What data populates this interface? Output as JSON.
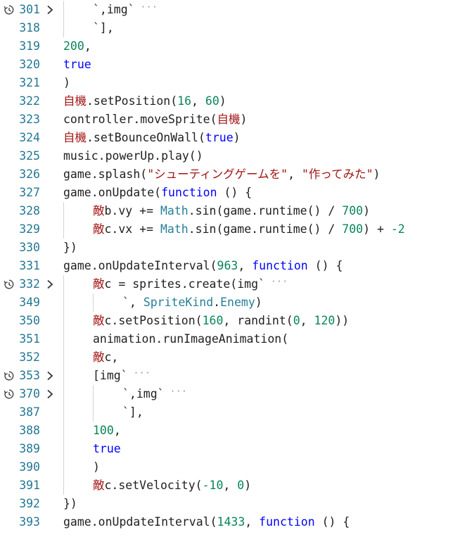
{
  "editor": {
    "lines": [
      {
        "num": "301",
        "folded": true,
        "indent": 1,
        "tokens": [
          {
            "t": "`,img`",
            "c": "id"
          },
          {
            "t": " ···",
            "c": "dots"
          }
        ]
      },
      {
        "num": "318",
        "indent": 1,
        "tokens": [
          {
            "t": "`],",
            "c": "id"
          }
        ]
      },
      {
        "num": "319",
        "indent": 0,
        "tokens": [
          {
            "t": "200",
            "c": "num"
          },
          {
            "t": ",",
            "c": "id"
          }
        ]
      },
      {
        "num": "320",
        "indent": 0,
        "tokens": [
          {
            "t": "true",
            "c": "kw"
          }
        ]
      },
      {
        "num": "321",
        "indent": 0,
        "tokens": [
          {
            "t": ")",
            "c": "id"
          }
        ]
      },
      {
        "num": "322",
        "indent": 0,
        "tokens": [
          {
            "t": "自機",
            "c": "jp"
          },
          {
            "t": ".setPosition(",
            "c": "id"
          },
          {
            "t": "16",
            "c": "num"
          },
          {
            "t": ", ",
            "c": "id"
          },
          {
            "t": "60",
            "c": "num"
          },
          {
            "t": ")",
            "c": "id"
          }
        ]
      },
      {
        "num": "323",
        "indent": 0,
        "tokens": [
          {
            "t": "controller.moveSprite(",
            "c": "id"
          },
          {
            "t": "自機",
            "c": "jp"
          },
          {
            "t": ")",
            "c": "id"
          }
        ]
      },
      {
        "num": "324",
        "indent": 0,
        "tokens": [
          {
            "t": "自機",
            "c": "jp"
          },
          {
            "t": ".setBounceOnWall(",
            "c": "id"
          },
          {
            "t": "true",
            "c": "kw"
          },
          {
            "t": ")",
            "c": "id"
          }
        ]
      },
      {
        "num": "325",
        "indent": 0,
        "tokens": [
          {
            "t": "music.powerUp.play()",
            "c": "id"
          }
        ]
      },
      {
        "num": "326",
        "indent": 0,
        "tokens": [
          {
            "t": "game.splash(",
            "c": "id"
          },
          {
            "t": "\"シューティングゲームを\"",
            "c": "str"
          },
          {
            "t": ", ",
            "c": "id"
          },
          {
            "t": "\"作ってみた\"",
            "c": "str"
          },
          {
            "t": ")",
            "c": "id"
          }
        ]
      },
      {
        "num": "327",
        "indent": 0,
        "tokens": [
          {
            "t": "game.onUpdate(",
            "c": "id"
          },
          {
            "t": "function",
            "c": "kw"
          },
          {
            "t": " () {",
            "c": "id"
          }
        ]
      },
      {
        "num": "328",
        "indent": 1,
        "tokens": [
          {
            "t": "敵",
            "c": "jp"
          },
          {
            "t": "b.vy += ",
            "c": "id"
          },
          {
            "t": "Math",
            "c": "class"
          },
          {
            "t": ".sin(game.runtime() / ",
            "c": "id"
          },
          {
            "t": "700",
            "c": "num"
          },
          {
            "t": ")",
            "c": "id"
          }
        ]
      },
      {
        "num": "329",
        "indent": 1,
        "tokens": [
          {
            "t": "敵",
            "c": "jp"
          },
          {
            "t": "c.vx += ",
            "c": "id"
          },
          {
            "t": "Math",
            "c": "class"
          },
          {
            "t": ".sin(game.runtime() / ",
            "c": "id"
          },
          {
            "t": "700",
            "c": "num"
          },
          {
            "t": ") + ",
            "c": "id"
          },
          {
            "t": "-2",
            "c": "num"
          }
        ]
      },
      {
        "num": "330",
        "indent": 0,
        "tokens": [
          {
            "t": "})",
            "c": "id"
          }
        ]
      },
      {
        "num": "331",
        "indent": 0,
        "tokens": [
          {
            "t": "game.onUpdateInterval(",
            "c": "id"
          },
          {
            "t": "963",
            "c": "num"
          },
          {
            "t": ", ",
            "c": "id"
          },
          {
            "t": "function",
            "c": "kw"
          },
          {
            "t": " () {",
            "c": "id"
          }
        ]
      },
      {
        "num": "332",
        "folded": true,
        "indent": 1,
        "tokens": [
          {
            "t": "敵",
            "c": "jp"
          },
          {
            "t": "c = sprites.create(img`",
            "c": "id"
          },
          {
            "t": " ···",
            "c": "dots"
          }
        ]
      },
      {
        "num": "349",
        "indent": 2,
        "tokens": [
          {
            "t": "`, ",
            "c": "id"
          },
          {
            "t": "SpriteKind",
            "c": "class"
          },
          {
            "t": ".",
            "c": "id"
          },
          {
            "t": "Enemy",
            "c": "class"
          },
          {
            "t": ")",
            "c": "id"
          }
        ]
      },
      {
        "num": "350",
        "indent": 1,
        "tokens": [
          {
            "t": "敵",
            "c": "jp"
          },
          {
            "t": "c.setPosition(",
            "c": "id"
          },
          {
            "t": "160",
            "c": "num"
          },
          {
            "t": ", randint(",
            "c": "id"
          },
          {
            "t": "0",
            "c": "num"
          },
          {
            "t": ", ",
            "c": "id"
          },
          {
            "t": "120",
            "c": "num"
          },
          {
            "t": "))",
            "c": "id"
          }
        ]
      },
      {
        "num": "351",
        "indent": 1,
        "tokens": [
          {
            "t": "animation.runImageAnimation(",
            "c": "id"
          }
        ]
      },
      {
        "num": "352",
        "indent": 1,
        "tokens": [
          {
            "t": "敵",
            "c": "jp"
          },
          {
            "t": "c,",
            "c": "id"
          }
        ]
      },
      {
        "num": "353",
        "folded": true,
        "indent": 1,
        "tokens": [
          {
            "t": "[img`",
            "c": "id"
          },
          {
            "t": " ···",
            "c": "dots"
          }
        ]
      },
      {
        "num": "370",
        "folded": true,
        "indent": 2,
        "tokens": [
          {
            "t": "`,img`",
            "c": "id"
          },
          {
            "t": " ···",
            "c": "dots"
          }
        ]
      },
      {
        "num": "387",
        "indent": 2,
        "tokens": [
          {
            "t": "`],",
            "c": "id"
          }
        ]
      },
      {
        "num": "388",
        "indent": 1,
        "tokens": [
          {
            "t": "100",
            "c": "num"
          },
          {
            "t": ",",
            "c": "id"
          }
        ]
      },
      {
        "num": "389",
        "indent": 1,
        "tokens": [
          {
            "t": "true",
            "c": "kw"
          }
        ]
      },
      {
        "num": "390",
        "indent": 1,
        "tokens": [
          {
            "t": ")",
            "c": "id"
          }
        ]
      },
      {
        "num": "391",
        "indent": 1,
        "tokens": [
          {
            "t": "敵",
            "c": "jp"
          },
          {
            "t": "c.setVelocity(",
            "c": "id"
          },
          {
            "t": "-10",
            "c": "num"
          },
          {
            "t": ", ",
            "c": "id"
          },
          {
            "t": "0",
            "c": "num"
          },
          {
            "t": ")",
            "c": "id"
          }
        ]
      },
      {
        "num": "392",
        "indent": 0,
        "tokens": [
          {
            "t": "})",
            "c": "id"
          }
        ]
      },
      {
        "num": "393",
        "indent": 0,
        "tokens": [
          {
            "t": "game.onUpdateInterval(",
            "c": "id"
          },
          {
            "t": "1433",
            "c": "num"
          },
          {
            "t": ", ",
            "c": "id"
          },
          {
            "t": "function",
            "c": "kw"
          },
          {
            "t": " () {",
            "c": "id"
          }
        ]
      }
    ]
  },
  "icons": {
    "folded_glyph": "collapsed-region-icon",
    "fold_toggle": "chevron-right-icon"
  },
  "colors": {
    "background": "#ffffff",
    "line_number": "#237893",
    "identifier": "#1f1f1f",
    "number": "#098658",
    "keyword": "#0000ff",
    "string": "#a31515",
    "type": "#267f99",
    "indent_guide": "#d3d3d3"
  }
}
